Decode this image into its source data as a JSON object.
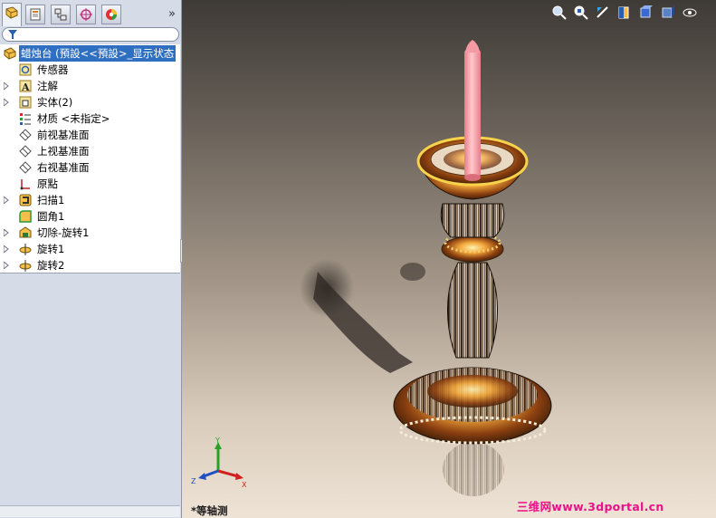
{
  "feature_manager": {
    "tabs": [
      {
        "icon": "feature-tree-icon",
        "active": true
      },
      {
        "icon": "property-manager-icon",
        "active": false
      },
      {
        "icon": "configuration-manager-icon",
        "active": false
      },
      {
        "icon": "dimxpert-icon",
        "active": false
      },
      {
        "icon": "display-manager-icon",
        "active": false
      }
    ],
    "more_label": "»",
    "filter_icon": "filter-icon",
    "tree": [
      {
        "label": "蜡烛台 (預設<<預設>_显示状态",
        "icon": "part-icon",
        "expander": false,
        "selected": true
      },
      {
        "label": "传感器",
        "icon": "sensor-icon",
        "expander": false
      },
      {
        "label": "注解",
        "icon": "annotation-icon",
        "expander": true
      },
      {
        "label": "实体(2)",
        "icon": "solid-bodies-icon",
        "expander": true
      },
      {
        "label": "材质 <未指定>",
        "icon": "material-icon",
        "expander": false
      },
      {
        "label": "前视基准面",
        "icon": "plane-icon",
        "expander": false
      },
      {
        "label": "上视基准面",
        "icon": "plane-icon",
        "expander": false
      },
      {
        "label": "右视基准面",
        "icon": "plane-icon",
        "expander": false
      },
      {
        "label": "原點",
        "icon": "origin-icon",
        "expander": false
      },
      {
        "label": "扫描1",
        "icon": "sweep-icon",
        "expander": true
      },
      {
        "label": "圆角1",
        "icon": "fillet-icon",
        "expander": false
      },
      {
        "label": "切除-旋转1",
        "icon": "cut-revolve-icon",
        "expander": true
      },
      {
        "label": "旋转1",
        "icon": "revolve-icon",
        "expander": true
      },
      {
        "label": "旋转2",
        "icon": "revolve-icon",
        "expander": true
      }
    ]
  },
  "viewport": {
    "view_name": "*等轴测",
    "watermark": "三维网www.3dportal.cn",
    "toolbar": [
      "zoom-to-fit-icon",
      "zoom-to-area-icon",
      "previous-view-icon",
      "section-view-icon",
      "view-orientation-icon",
      "display-style-icon",
      "hide-show-items-icon"
    ],
    "triad_axes": [
      "Y",
      "Z",
      "X"
    ],
    "colors": {
      "candle": "#f59aa2",
      "candle_highlight": "#ffd6d8",
      "gold": "#f2a63a",
      "chrome_dark": "#3a2410",
      "selection": "#2f6fc1",
      "watermark": "#e8128a"
    }
  }
}
